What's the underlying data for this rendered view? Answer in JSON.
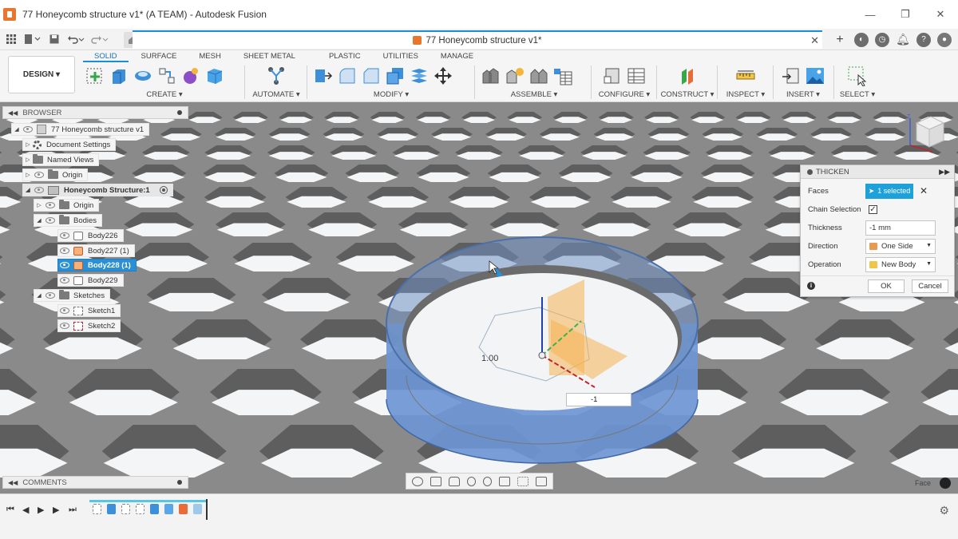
{
  "window": {
    "title": "77 Honeycomb structure v1* (A TEAM) - Autodesk Fusion",
    "controls": [
      "—",
      "❐",
      "✕"
    ]
  },
  "doc_tab": {
    "title": "77 Honeycomb structure v1*"
  },
  "workspace": {
    "label": "DESIGN ▾"
  },
  "tabs": [
    "SOLID",
    "SURFACE",
    "MESH",
    "SHEET METAL",
    "PLASTIC",
    "UTILITIES",
    "MANAGE"
  ],
  "groups": {
    "create": "CREATE ▾",
    "automate": "AUTOMATE ▾",
    "modify": "MODIFY ▾",
    "assemble": "ASSEMBLE ▾",
    "configure": "CONFIGURE ▾",
    "construct": "CONSTRUCT ▾",
    "inspect": "INSPECT ▾",
    "insert": "INSERT ▾",
    "select": "SELECT ▾"
  },
  "browser": {
    "title": "BROWSER",
    "rows": {
      "root": "77 Honeycomb structure v1",
      "doc_settings": "Document Settings",
      "named_views": "Named Views",
      "origin": "Origin",
      "component": "Honeycomb Structure:1",
      "comp_origin": "Origin",
      "bodies": "Bodies",
      "body226": "Body226",
      "body227": "Body227 (1)",
      "body228": "Body228 (1)",
      "body229": "Body229",
      "sketches": "Sketches",
      "sketch1": "Sketch1",
      "sketch2": "Sketch2"
    }
  },
  "comments": {
    "title": "COMMENTS"
  },
  "thicken": {
    "title": "THICKEN",
    "faces_label": "Faces",
    "faces_value": "1 selected",
    "chain_label": "Chain Selection",
    "chain_checked": true,
    "thickness_label": "Thickness",
    "thickness_value": "-1 mm",
    "direction_label": "Direction",
    "direction_value": "One Side",
    "operation_label": "Operation",
    "operation_value": "New Body",
    "ok": "OK",
    "cancel": "Cancel"
  },
  "viewport": {
    "measure_label": "1.00",
    "inline_value": "-1",
    "status": "Face"
  },
  "colors": {
    "accent": "#1a8fd6",
    "selection": "#2b8fd6",
    "ring": "#6f97d4",
    "honeycomb": "#8a8a8a"
  }
}
